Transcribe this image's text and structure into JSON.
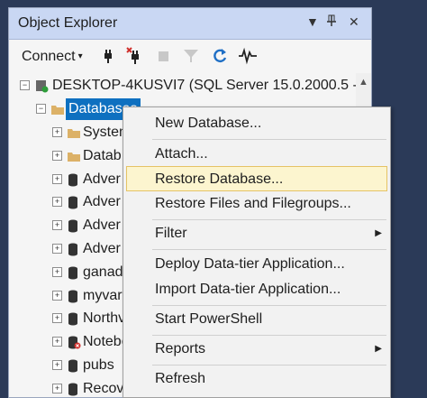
{
  "panel": {
    "title": "Object Explorer",
    "dropdown_glyph": "▼",
    "pin_glyph": "⊥",
    "close_glyph": "✕"
  },
  "toolbar": {
    "connect_label": "Connect",
    "caret": "▾",
    "icons": [
      "connect-plug-icon",
      "disconnect-icon",
      "stop-icon",
      "filter-icon",
      "refresh-icon",
      "activity-monitor-icon"
    ]
  },
  "tree": {
    "server_label": "DESKTOP-4KUSVI7 (SQL Server 15.0.2000.5 -",
    "databases_label": "Databases",
    "children": [
      "System",
      "Datab",
      "Adver",
      "Adver",
      "Adver",
      "Adver",
      "ganad",
      "myvar",
      "Northv",
      "Notebc",
      "pubs",
      "Recove"
    ]
  },
  "scroll": {
    "up_glyph": "▲"
  },
  "context_menu": {
    "items": [
      {
        "label": "New Database..."
      },
      {
        "label": "Attach..."
      },
      {
        "label": "Restore Database...",
        "highlighted": true
      },
      {
        "label": "Restore Files and Filegroups..."
      },
      {
        "label": "Filter",
        "submenu": true
      },
      {
        "label": "Deploy Data-tier Application..."
      },
      {
        "label": "Import Data-tier Application..."
      },
      {
        "label": "Start PowerShell"
      },
      {
        "label": "Reports",
        "submenu": true
      },
      {
        "label": "Refresh"
      }
    ],
    "submenu_glyph": "▶"
  },
  "colors": {
    "selection": "#0e70c0",
    "highlight_bg": "#fcf5cf",
    "highlight_border": "#e5c365",
    "titlebar": "#c9d7f3"
  }
}
